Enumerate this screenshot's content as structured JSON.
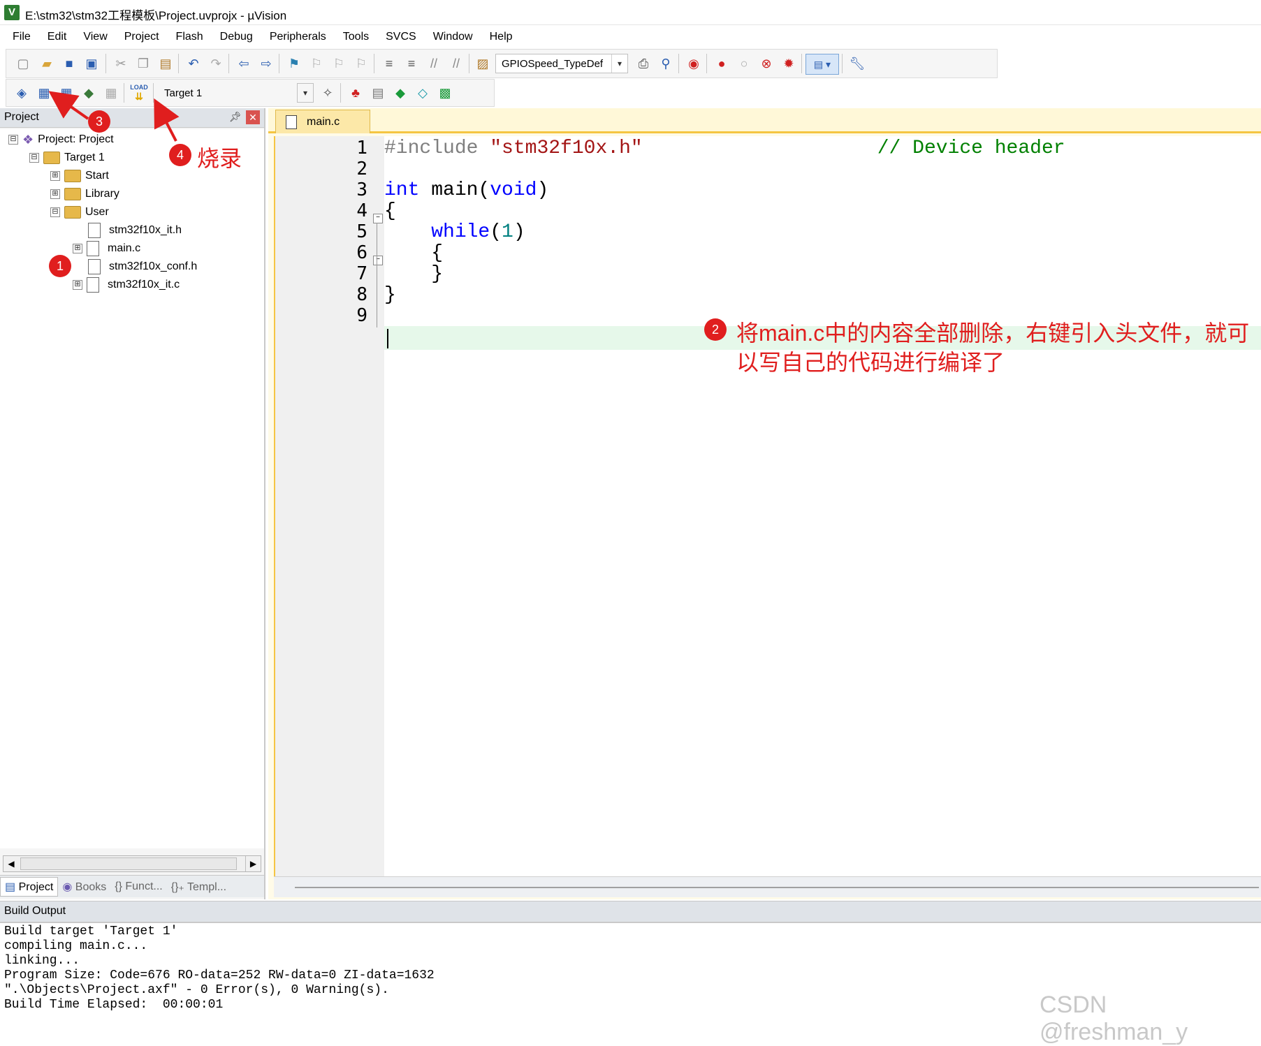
{
  "window": {
    "title": "E:\\stm32\\stm32工程模板\\Project.uvprojx - µVision",
    "logo": "V"
  },
  "menu": [
    "File",
    "Edit",
    "View",
    "Project",
    "Flash",
    "Debug",
    "Peripherals",
    "Tools",
    "SVCS",
    "Window",
    "Help"
  ],
  "toolbar1": {
    "find_combo_value": "GPIOSpeed_TypeDef"
  },
  "toolbar2": {
    "target_combo_value": "Target 1",
    "load_label": "LOAD"
  },
  "project_panel": {
    "title": "Project",
    "tree": [
      {
        "label": "Project: Project",
        "depth": 0,
        "expander": "⊟",
        "kind": "root"
      },
      {
        "label": "Target 1",
        "depth": 1,
        "expander": "⊟",
        "kind": "target"
      },
      {
        "label": "Start",
        "depth": 2,
        "expander": "⊞",
        "kind": "folder"
      },
      {
        "label": "Library",
        "depth": 2,
        "expander": "⊞",
        "kind": "folder"
      },
      {
        "label": "User",
        "depth": 2,
        "expander": "⊟",
        "kind": "folder"
      },
      {
        "label": "stm32f10x_it.h",
        "depth": 3,
        "expander": "",
        "kind": "file"
      },
      {
        "label": "main.c",
        "depth": 3,
        "expander": "⊞",
        "kind": "file"
      },
      {
        "label": "stm32f10x_conf.h",
        "depth": 3,
        "expander": "",
        "kind": "file"
      },
      {
        "label": "stm32f10x_it.c",
        "depth": 3,
        "expander": "⊞",
        "kind": "file"
      }
    ],
    "tabs": [
      "Project",
      "Books",
      "{} Funct...",
      "{}₊ Templ..."
    ]
  },
  "editor": {
    "tab": "main.c",
    "lines": [
      {
        "n": "1",
        "segments": [
          {
            "t": "#include ",
            "c": "#7f7f7f"
          },
          {
            "t": "\"stm32f10x.h\"",
            "c": "#a31515"
          },
          {
            "t": "                    // Device header",
            "c": "#008000"
          }
        ]
      },
      {
        "n": "2",
        "segments": []
      },
      {
        "n": "3",
        "segments": [
          {
            "t": "int",
            "c": "#0000ff"
          },
          {
            "t": " main(",
            "c": "#000000"
          },
          {
            "t": "void",
            "c": "#0000ff"
          },
          {
            "t": ")",
            "c": "#000000"
          }
        ]
      },
      {
        "n": "4",
        "segments": [
          {
            "t": "{",
            "c": "#000000"
          }
        ]
      },
      {
        "n": "5",
        "segments": [
          {
            "t": "    ",
            "c": "#000000"
          },
          {
            "t": "while",
            "c": "#0000ff"
          },
          {
            "t": "(",
            "c": "#000000"
          },
          {
            "t": "1",
            "c": "#008080"
          },
          {
            "t": ")",
            "c": "#000000"
          }
        ]
      },
      {
        "n": "6",
        "segments": [
          {
            "t": "    {",
            "c": "#000000"
          }
        ]
      },
      {
        "n": "7",
        "segments": [
          {
            "t": "    }",
            "c": "#000000"
          }
        ]
      },
      {
        "n": "8",
        "segments": [
          {
            "t": "}",
            "c": "#000000"
          }
        ]
      },
      {
        "n": "9",
        "segments": []
      }
    ]
  },
  "build_output": {
    "title": "Build Output",
    "lines": [
      "Build target 'Target 1'",
      "compiling main.c...",
      "linking...",
      "Program Size: Code=676 RO-data=252 RW-data=0 ZI-data=1632",
      "\".\\Objects\\Project.axf\" - 0 Error(s), 0 Warning(s).",
      "Build Time Elapsed:  00:00:01"
    ]
  },
  "annotations": {
    "badge1": "1",
    "badge2": "2",
    "badge3": "3",
    "badge4": "4",
    "label4": "烧录",
    "note2_line1": "将main.c中的内容全部删除，右键引入头文件，就可",
    "note2_line2": "以写自己的代码进行编译了",
    "color": "#e01e1e"
  },
  "watermark": "CSDN @freshman_y"
}
